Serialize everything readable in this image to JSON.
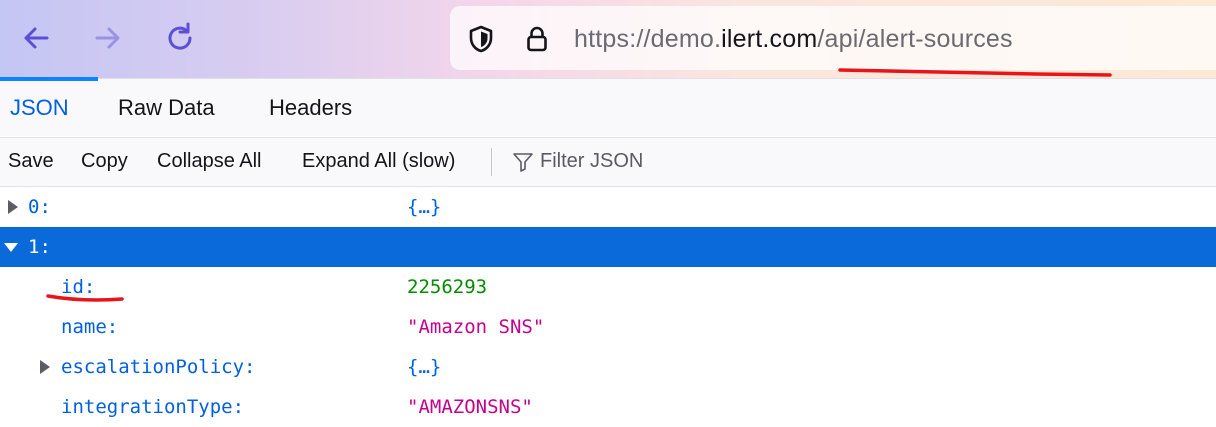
{
  "browser": {
    "url_prefix": "https://demo.",
    "url_domain": "ilert.com",
    "url_path": "/api/alert-sources"
  },
  "viewer": {
    "tabs": [
      {
        "label": "JSON",
        "active": true
      },
      {
        "label": "Raw Data",
        "active": false
      },
      {
        "label": "Headers",
        "active": false
      }
    ],
    "toolbar": {
      "save": "Save",
      "copy": "Copy",
      "collapse_all": "Collapse All",
      "expand_all": "Expand All (slow)",
      "filter_placeholder": "Filter JSON"
    },
    "rows": [
      {
        "key": "0:",
        "value": "{…}",
        "type": "object",
        "expanded": false,
        "selected": false
      },
      {
        "key": "1:",
        "value": "",
        "type": "object",
        "expanded": true,
        "selected": true
      },
      {
        "key": "id:",
        "value": "2256293",
        "type": "number"
      },
      {
        "key": "name:",
        "value": "\"Amazon SNS\"",
        "type": "string"
      },
      {
        "key": "escalationPolicy:",
        "value": "{…}",
        "type": "object",
        "expanded": false
      },
      {
        "key": "integrationType:",
        "value": "\"AMAZONSNS\"",
        "type": "string"
      }
    ]
  },
  "colors": {
    "accent": "#0a84ff",
    "selection": "#0a6ad9",
    "key": "#0060df",
    "number": "#058b00",
    "string": "#c5008c",
    "annotation": "#e8141a"
  }
}
